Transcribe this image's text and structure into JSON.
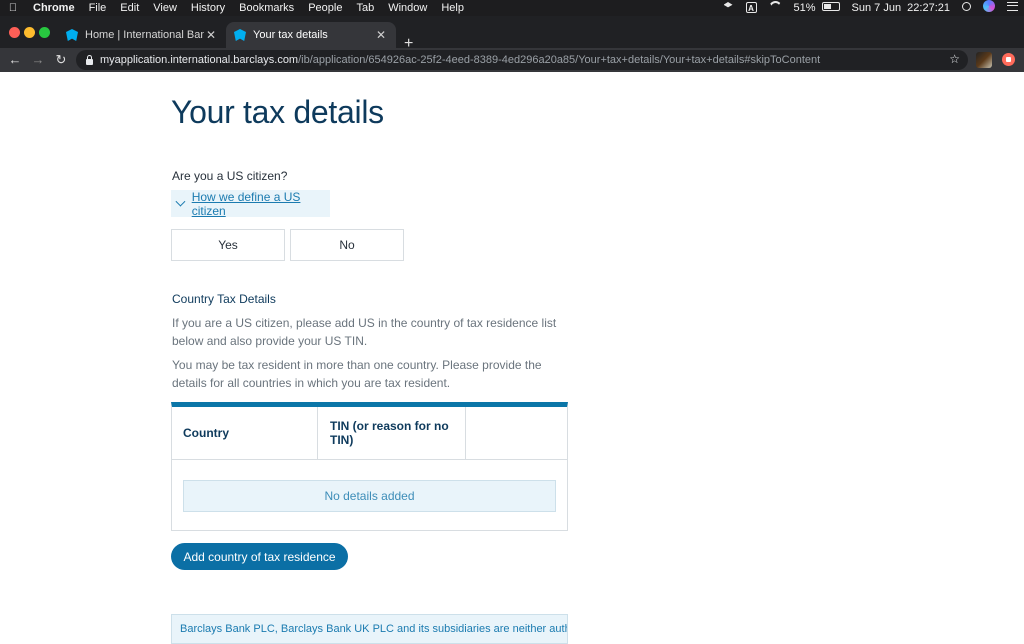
{
  "menubar": {
    "app": "Chrome",
    "items": [
      "File",
      "Edit",
      "View",
      "History",
      "Bookmarks",
      "People",
      "Tab",
      "Window",
      "Help"
    ],
    "battery": "51%",
    "datetime": "Sun 7 Jun  22:27:21",
    "input_source": "A"
  },
  "tabs": [
    {
      "label": "Home | International Banking |"
    },
    {
      "label": "Your tax details"
    }
  ],
  "address": {
    "host": "myapplication.international.barclays.com",
    "path": "/ib/application/654926ac-25f2-4eed-8389-4ed296a20a85/Your+tax+details/Your+tax+details#skipToContent"
  },
  "page": {
    "title": "Your tax details",
    "us_question": "Are you a US citizen?",
    "define_link": "How we define a US citizen",
    "yes_label": "Yes",
    "no_label": "No",
    "section_heading": "Country Tax Details",
    "para1": "If you are a US citizen, please add US in the country of tax residence list below and also provide your US TIN.",
    "para2": "You may be tax resident in more than one country. Please provide the details for all countries in which you are tax resident.",
    "table": {
      "col_country": "Country",
      "col_tin": "TIN (or reason for no TIN)",
      "empty_message": "No details added"
    },
    "add_button": "Add country of tax residence",
    "footer_note": "Barclays Bank PLC, Barclays Bank UK PLC and its subsidiaries are neither authorised"
  },
  "colors": {
    "title": "#0e3a5c",
    "link": "#1b7bb0",
    "primary_button": "#0b6fa5",
    "table_accent": "#0b76a8",
    "info_background": "#e9f4fa"
  },
  "icons": [
    "apple-icon",
    "dropbox-icon",
    "wifi-icon",
    "battery-icon",
    "spotlight-search-icon",
    "siri-icon",
    "notification-list-icon",
    "barclays-favicon",
    "close-tab-icon",
    "new-tab-icon",
    "back-icon",
    "forward-icon",
    "reload-icon",
    "lock-icon",
    "bookmark-star-icon",
    "chevron-down-icon"
  ]
}
